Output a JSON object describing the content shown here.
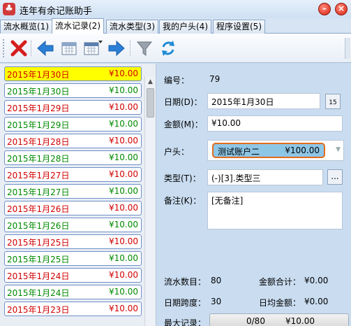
{
  "window": {
    "title": "连年有余记账助手"
  },
  "tabs": [
    {
      "label": "流水概览(1)"
    },
    {
      "label": "流水记录(2)"
    },
    {
      "label": "流水类型(3)"
    },
    {
      "label": "我的户头(4)"
    },
    {
      "label": "程序设置(5)"
    }
  ],
  "records": [
    {
      "date": "2015年1月30日",
      "amount": "¥10.00",
      "color": "red",
      "selected": true
    },
    {
      "date": "2015年1月30日",
      "amount": "¥10.00",
      "color": "green"
    },
    {
      "date": "2015年1月29日",
      "amount": "¥10.00",
      "color": "red"
    },
    {
      "date": "2015年1月29日",
      "amount": "¥10.00",
      "color": "green"
    },
    {
      "date": "2015年1月28日",
      "amount": "¥10.00",
      "color": "red"
    },
    {
      "date": "2015年1月28日",
      "amount": "¥10.00",
      "color": "green"
    },
    {
      "date": "2015年1月27日",
      "amount": "¥10.00",
      "color": "red"
    },
    {
      "date": "2015年1月27日",
      "amount": "¥10.00",
      "color": "green"
    },
    {
      "date": "2015年1月26日",
      "amount": "¥10.00",
      "color": "red"
    },
    {
      "date": "2015年1月26日",
      "amount": "¥10.00",
      "color": "green"
    },
    {
      "date": "2015年1月25日",
      "amount": "¥10.00",
      "color": "red"
    },
    {
      "date": "2015年1月25日",
      "amount": "¥10.00",
      "color": "green"
    },
    {
      "date": "2015年1月24日",
      "amount": "¥10.00",
      "color": "red"
    },
    {
      "date": "2015年1月24日",
      "amount": "¥10.00",
      "color": "green"
    },
    {
      "date": "2015年1月23日",
      "amount": "¥10.00",
      "color": "red"
    }
  ],
  "detail": {
    "id_label": "编号：",
    "id_value": "79",
    "date_label": "日期(D)：",
    "date_value": "2015年1月30日",
    "calendar_day": "15",
    "amount_label": "金额(M)：",
    "amount_value": "¥10.00",
    "account_label": "户头：",
    "account_name": "测试账户二",
    "account_amount": "¥100.00",
    "type_label": "类型(T)：",
    "type_value": "(-)[3].类型三",
    "type_button": "...",
    "note_label": "备注(K)：",
    "note_value": "[无备注]",
    "count_label": "流水数目：",
    "count_value": "80",
    "total_label": "金额合计：",
    "total_value": "¥0.00",
    "span_label": "日期跨度：",
    "span_value": "30",
    "daily_label": "日均金额：",
    "daily_value": "¥0.00",
    "max_label": "最大记录：",
    "max_count": "0/80",
    "max_amount": "¥10.00",
    "max_progress": 0
  },
  "colors": {
    "red": "#d10000",
    "green": "#008a00",
    "selected": "#ffff00",
    "account": "#8ec6e6"
  }
}
